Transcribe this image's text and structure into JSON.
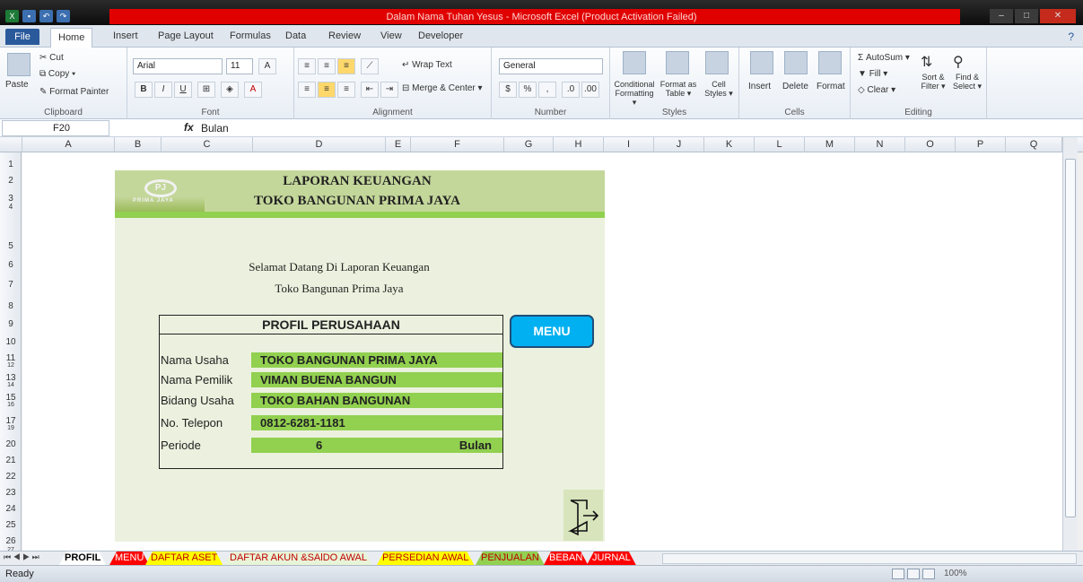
{
  "window": {
    "title": "Dalam Nama Tuhan Yesus  -  Microsoft Excel (Product Activation Failed)"
  },
  "ribbon_tabs": [
    {
      "label": "File"
    },
    {
      "label": "Home"
    },
    {
      "label": "Insert"
    },
    {
      "label": "Page Layout"
    },
    {
      "label": "Formulas"
    },
    {
      "label": "Data"
    },
    {
      "label": "Review"
    },
    {
      "label": "View"
    },
    {
      "label": "Developer"
    }
  ],
  "ribbon": {
    "clipboard": {
      "label": "Clipboard",
      "paste": "Paste",
      "cut": "Cut",
      "copy": "Copy ▾",
      "format_painter": "Format Painter"
    },
    "font": {
      "label": "Font",
      "name": "Arial",
      "size": "11"
    },
    "alignment": {
      "label": "Alignment",
      "wrap": "Wrap Text",
      "merge": "Merge & Center ▾"
    },
    "number": {
      "label": "Number",
      "format": "General"
    },
    "styles": {
      "label": "Styles",
      "conditional": "Conditional Formatting ▾",
      "format_table": "Format as Table ▾",
      "cell_styles": "Cell Styles ▾"
    },
    "cells": {
      "label": "Cells",
      "insert": "Insert",
      "delete": "Delete",
      "format": "Format"
    },
    "editing": {
      "label": "Editing",
      "autosum": "AutoSum ▾",
      "fill": "Fill ▾",
      "clear": "Clear ▾",
      "sort": "Sort & Filter ▾",
      "find": "Find & Select ▾"
    }
  },
  "formula_bar": {
    "name_box": "F20",
    "fx": "fx",
    "value": "Bulan"
  },
  "columns": [
    "A",
    "B",
    "C",
    "D",
    "E",
    "F",
    "G",
    "H",
    "I",
    "J",
    "K",
    "L",
    "M",
    "N",
    "O",
    "P",
    "Q"
  ],
  "rows": [
    "1",
    "2",
    "3",
    "4",
    "5",
    "6",
    "7",
    "8",
    "9",
    "10",
    "11",
    "12",
    "13",
    "14",
    "15",
    "16",
    "17",
    "19",
    "20",
    "21",
    "22",
    "23",
    "24",
    "25",
    "26",
    "27"
  ],
  "report": {
    "title1": "LAPORAN KEUANGAN",
    "title2": "TOKO BANGUNAN PRIMA JAYA",
    "logo_text": "PRIMA JAYA",
    "welcome1": "Selamat Datang Di Laporan Keuangan",
    "welcome2": "Toko Bangunan Prima Jaya",
    "profile_title": "PROFIL PERUSAHAAN",
    "fields": [
      {
        "label": "Nama Usaha",
        "value": "TOKO BANGUNAN PRIMA JAYA"
      },
      {
        "label": "Nama Pemilik",
        "value": "VIMAN BUENA BANGUN"
      },
      {
        "label": "Bidang Usaha",
        "value": "TOKO BAHAN BANGUNAN"
      },
      {
        "label": "No. Telepon",
        "value": "0812-6281-1181"
      }
    ],
    "periode": {
      "label": "Periode",
      "value": "6",
      "unit": "Bulan"
    },
    "menu_button": "MENU"
  },
  "sheet_tabs": [
    {
      "label": "PROFIL",
      "color": "#ffffff"
    },
    {
      "label": "MENU",
      "color": "#ff0000"
    },
    {
      "label": "DAFTAR ASET",
      "color": "#ffff00"
    },
    {
      "label": "DAFTAR AKUN &SAlDO AWAL",
      "color": "#e8f4d8"
    },
    {
      "label": "PERSEDIAN AWAL",
      "color": "#ffff00"
    },
    {
      "label": "PENJUALAN",
      "color": "#92d050"
    },
    {
      "label": "BEBAN",
      "color": "#ff0000"
    },
    {
      "label": "JURNAL",
      "color": "#ff0000"
    }
  ],
  "status": {
    "ready": "Ready",
    "zoom": "100%"
  }
}
